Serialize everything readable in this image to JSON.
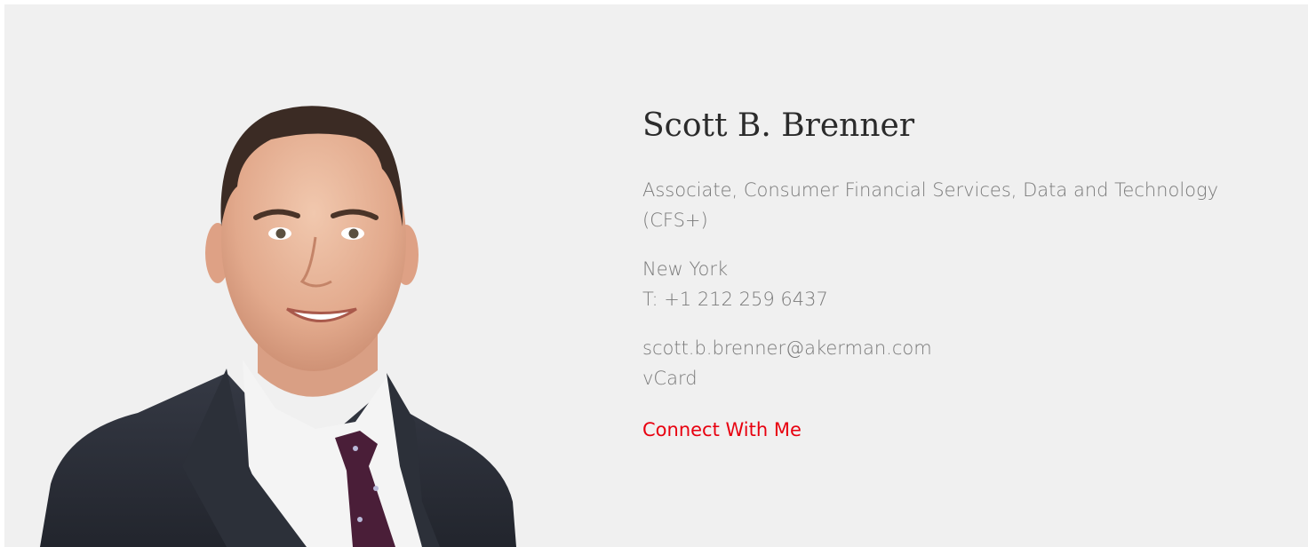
{
  "profile": {
    "name": "Scott B. Brenner",
    "title": "Associate, Consumer Financial Services, Data and Technology (CFS+)",
    "location": "New York",
    "phone": "T: +1 212 259 6437",
    "email": "scott.b.brenner@akerman.com",
    "vcard_label": "vCard",
    "connect_label": "Connect With Me"
  },
  "colors": {
    "background": "#f0f0f0",
    "name_text": "#2b2b2b",
    "body_text": "#7a7a7a",
    "accent": "#e8000f",
    "suit": "#2a2d36",
    "shirt": "#f4f4f4",
    "tie": "#4a1e38"
  }
}
